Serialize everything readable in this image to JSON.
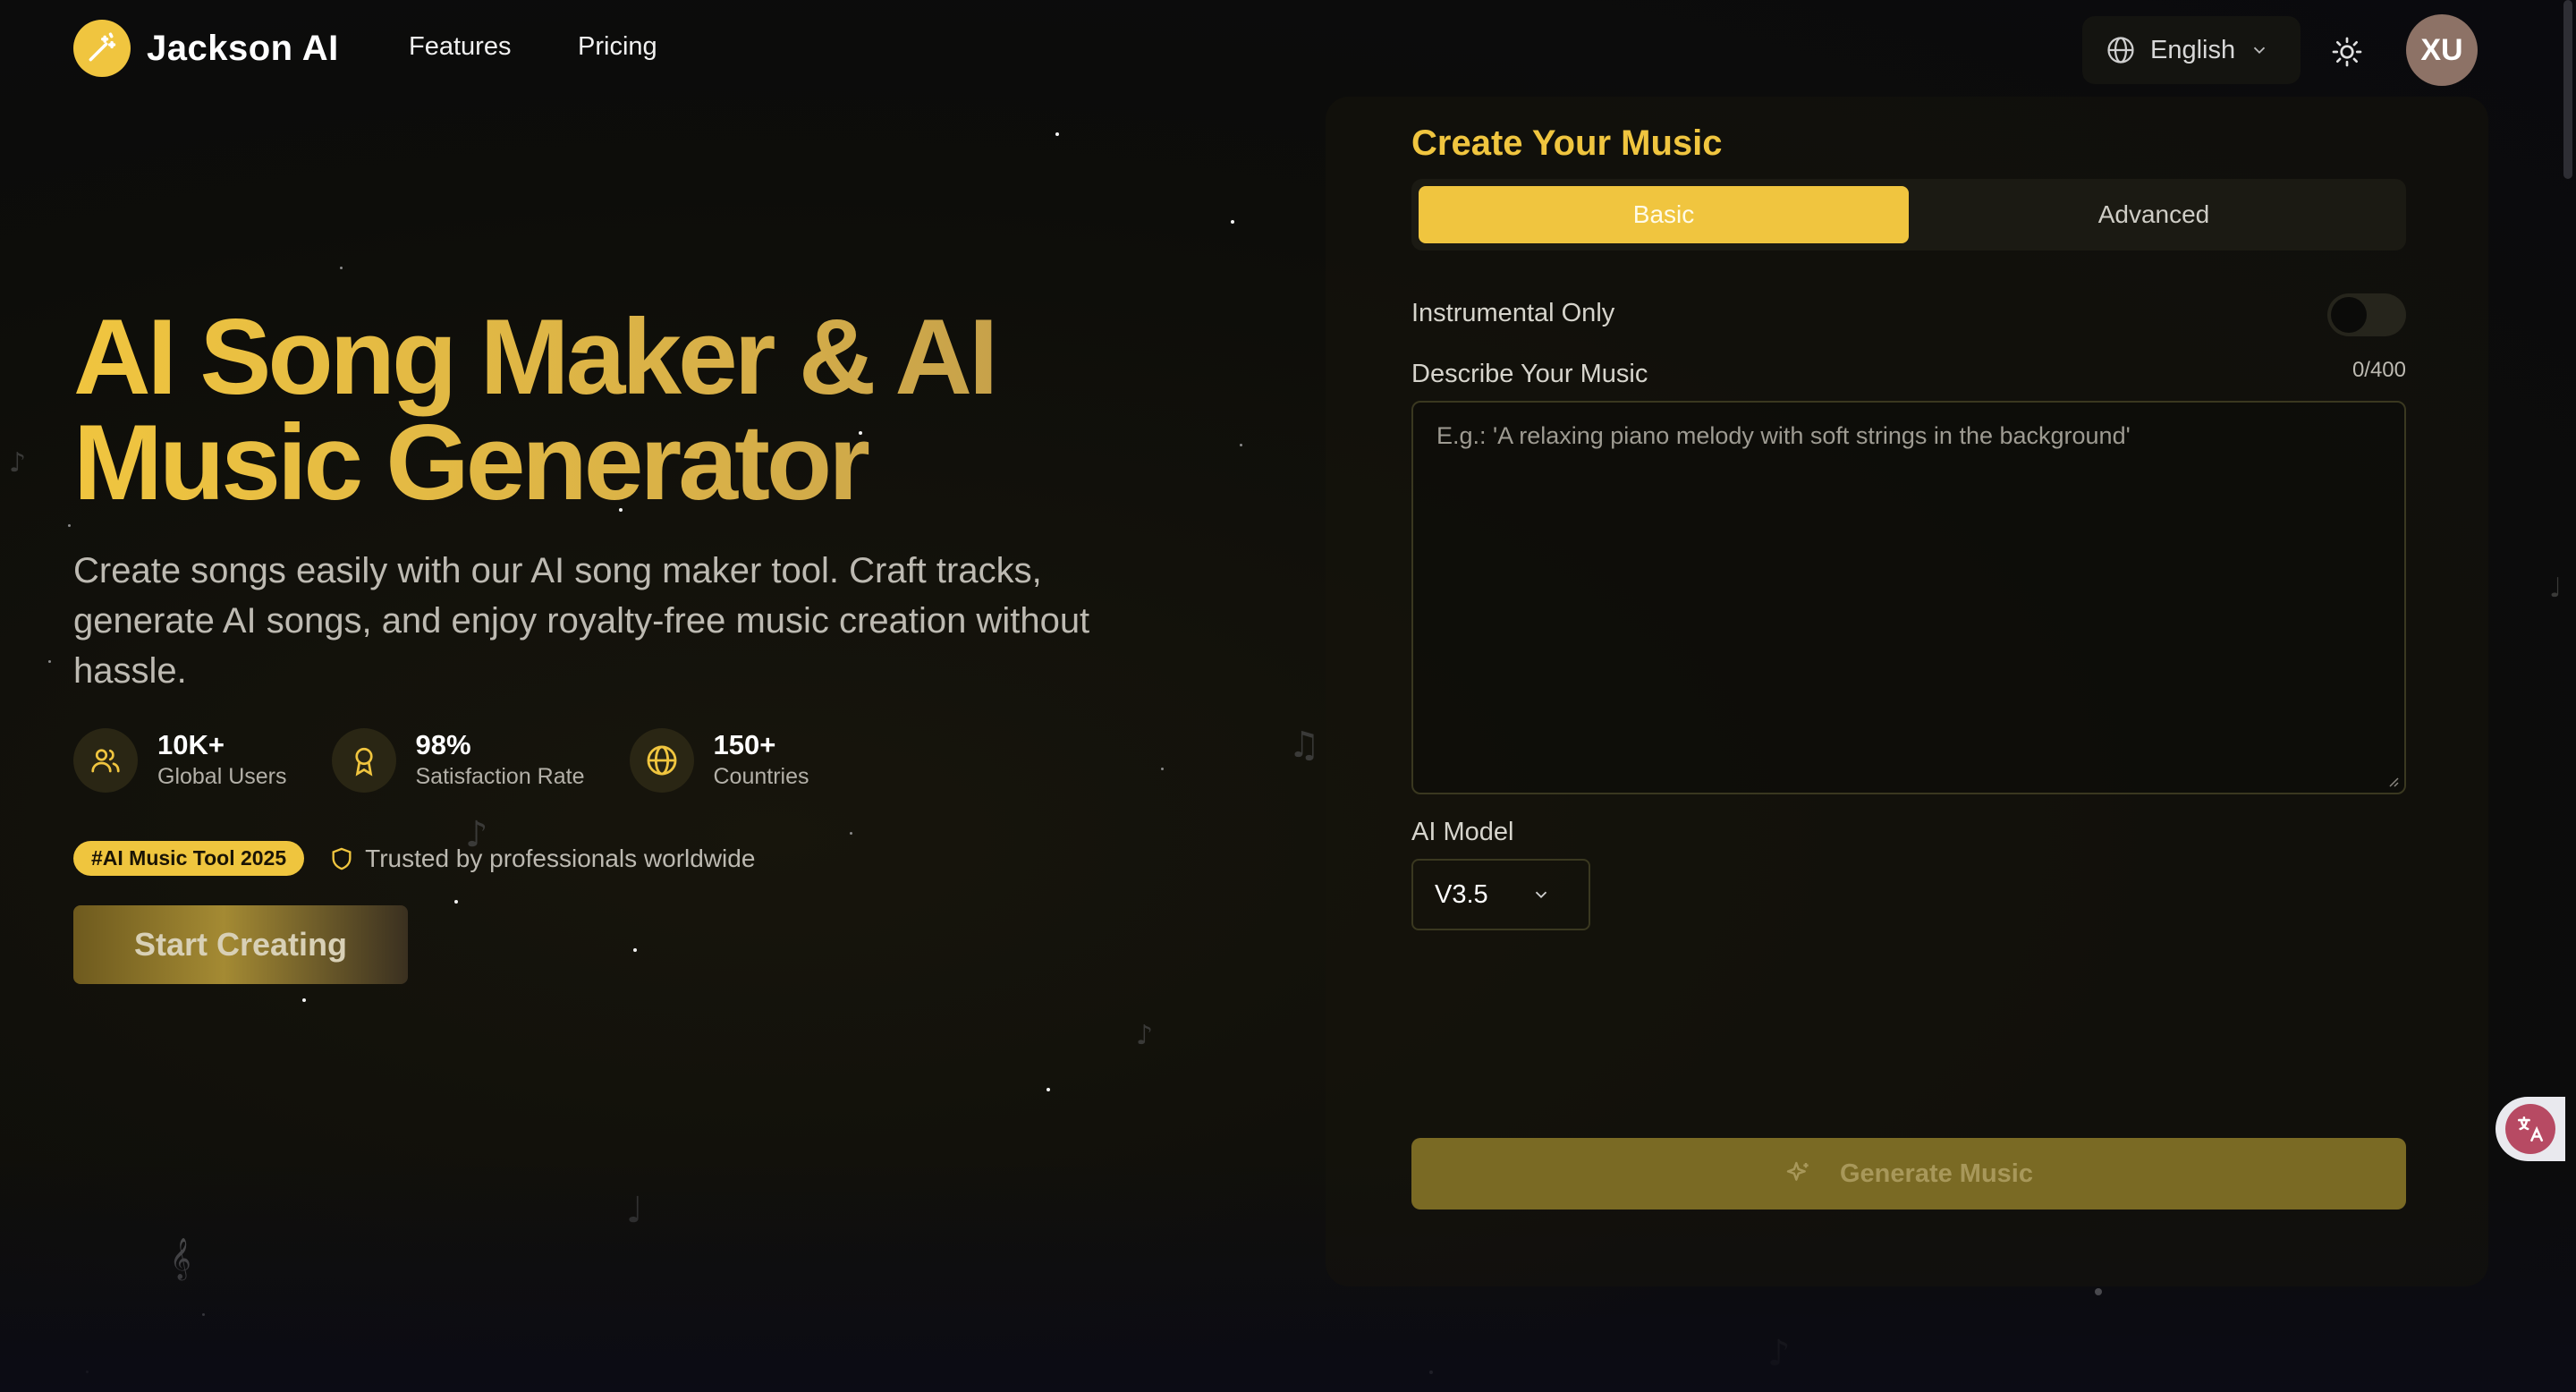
{
  "header": {
    "brand": "Jackson AI",
    "nav": [
      {
        "label": "Features"
      },
      {
        "label": "Pricing"
      }
    ],
    "language": "English",
    "avatar_initials": "XU"
  },
  "hero": {
    "title_line1": "AI Song Maker & AI",
    "title_line2": "Music Generator",
    "subtitle": "Create songs easily with our AI song maker tool. Craft tracks, generate AI songs, and enjoy royalty-free music creation without hassle.",
    "stats": [
      {
        "value": "10K+",
        "label": "Global Users",
        "icon": "users-icon"
      },
      {
        "value": "98%",
        "label": "Satisfaction Rate",
        "icon": "award-icon"
      },
      {
        "value": "150+",
        "label": "Countries",
        "icon": "globe-icon"
      }
    ],
    "badge": "#AI Music Tool 2025",
    "trusted": "Trusted by professionals worldwide",
    "cta": "Start Creating"
  },
  "panel": {
    "title": "Create Your Music",
    "tabs": [
      {
        "label": "Basic",
        "active": true
      },
      {
        "label": "Advanced",
        "active": false
      }
    ],
    "instrumental_label": "Instrumental Only",
    "instrumental_on": false,
    "describe_label": "Describe Your Music",
    "counter": "0/400",
    "describe_placeholder": "E.g.: 'A relaxing piano melody with soft strings in the background'",
    "model_label": "AI Model",
    "model_value": "V3.5",
    "generate_label": "Generate Music"
  },
  "colors": {
    "accent": "#f0c53f",
    "background": "#0d0d0a",
    "generate_button": "#7a6a24"
  }
}
